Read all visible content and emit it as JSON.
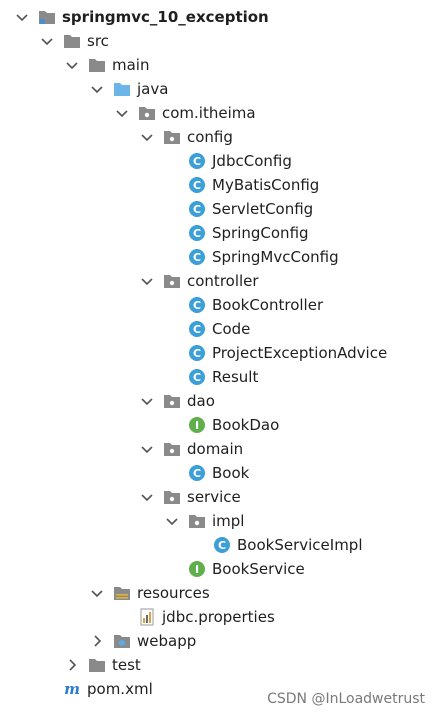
{
  "tree": [
    {
      "label": "springmvc_10_exception",
      "depth": 0,
      "icon": "module-folder-icon",
      "chevron": "expanded",
      "bold": true
    },
    {
      "label": "src",
      "depth": 1,
      "icon": "folder-icon",
      "chevron": "expanded"
    },
    {
      "label": "main",
      "depth": 2,
      "icon": "folder-icon",
      "chevron": "expanded"
    },
    {
      "label": "java",
      "depth": 3,
      "icon": "source-folder-icon",
      "chevron": "expanded"
    },
    {
      "label": "com.itheima",
      "depth": 4,
      "icon": "package-icon",
      "chevron": "expanded"
    },
    {
      "label": "config",
      "depth": 5,
      "icon": "package-icon",
      "chevron": "expanded"
    },
    {
      "label": "JdbcConfig",
      "depth": 6,
      "icon": "class-icon",
      "chevron": "none"
    },
    {
      "label": "MyBatisConfig",
      "depth": 6,
      "icon": "class-icon",
      "chevron": "none"
    },
    {
      "label": "ServletConfig",
      "depth": 6,
      "icon": "class-icon",
      "chevron": "none"
    },
    {
      "label": "SpringConfig",
      "depth": 6,
      "icon": "class-icon",
      "chevron": "none"
    },
    {
      "label": "SpringMvcConfig",
      "depth": 6,
      "icon": "class-icon",
      "chevron": "none"
    },
    {
      "label": "controller",
      "depth": 5,
      "icon": "package-icon",
      "chevron": "expanded"
    },
    {
      "label": "BookController",
      "depth": 6,
      "icon": "class-icon",
      "chevron": "none"
    },
    {
      "label": "Code",
      "depth": 6,
      "icon": "class-icon",
      "chevron": "none"
    },
    {
      "label": "ProjectExceptionAdvice",
      "depth": 6,
      "icon": "class-icon",
      "chevron": "none"
    },
    {
      "label": "Result",
      "depth": 6,
      "icon": "class-icon",
      "chevron": "none"
    },
    {
      "label": "dao",
      "depth": 5,
      "icon": "package-icon",
      "chevron": "expanded"
    },
    {
      "label": "BookDao",
      "depth": 6,
      "icon": "interface-icon",
      "chevron": "none"
    },
    {
      "label": "domain",
      "depth": 5,
      "icon": "package-icon",
      "chevron": "expanded"
    },
    {
      "label": "Book",
      "depth": 6,
      "icon": "class-icon",
      "chevron": "none"
    },
    {
      "label": "service",
      "depth": 5,
      "icon": "package-icon",
      "chevron": "expanded"
    },
    {
      "label": "impl",
      "depth": 6,
      "icon": "package-icon",
      "chevron": "expanded"
    },
    {
      "label": "BookServiceImpl",
      "depth": 7,
      "icon": "class-icon",
      "chevron": "none"
    },
    {
      "label": "BookService",
      "depth": 6,
      "icon": "interface-icon",
      "chevron": "none"
    },
    {
      "label": "resources",
      "depth": 3,
      "icon": "resources-folder-icon",
      "chevron": "expanded"
    },
    {
      "label": "jdbc.properties",
      "depth": 4,
      "icon": "properties-file-icon",
      "chevron": "none"
    },
    {
      "label": "webapp",
      "depth": 3,
      "icon": "web-folder-icon",
      "chevron": "collapsed"
    },
    {
      "label": "test",
      "depth": 2,
      "icon": "folder-icon",
      "chevron": "collapsed"
    },
    {
      "label": "pom.xml",
      "depth": 1,
      "icon": "maven-icon",
      "chevron": "none"
    }
  ],
  "watermark": "CSDN @InLoadwetrust",
  "colors": {
    "class_icon": "#3d9fd8",
    "interface_icon": "#5fb04a",
    "folder": "#8a8a8a",
    "source_folder": "#6ab6e8",
    "maven": "#2b7bd1",
    "text": "#1f1f1f"
  }
}
